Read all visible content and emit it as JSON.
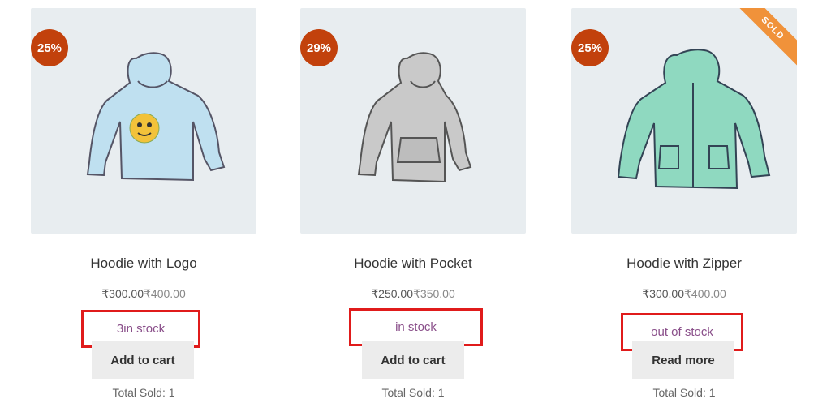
{
  "products": [
    {
      "discount": "25%",
      "title": "Hoodie with Logo",
      "price": "₹300.00",
      "old_price": "₹400.00",
      "stock": "3in stock",
      "button": "Add to cart",
      "sold_text": "Total Sold: 1",
      "color": "#bfe0f0"
    },
    {
      "discount": "29%",
      "title": "Hoodie with Pocket",
      "price": "₹250.00",
      "old_price": "₹350.00",
      "stock": "in stock",
      "button": "Add to cart",
      "sold_text": "Total Sold: 1",
      "color": "#c9c9c9"
    },
    {
      "discount": "25%",
      "title": "Hoodie with Zipper",
      "price": "₹300.00",
      "old_price": "₹400.00",
      "stock": "out of stock",
      "button": "Read more",
      "sold_text": "Total Sold: 1",
      "ribbon": "SOLD",
      "color": "#8fd9c0"
    }
  ]
}
